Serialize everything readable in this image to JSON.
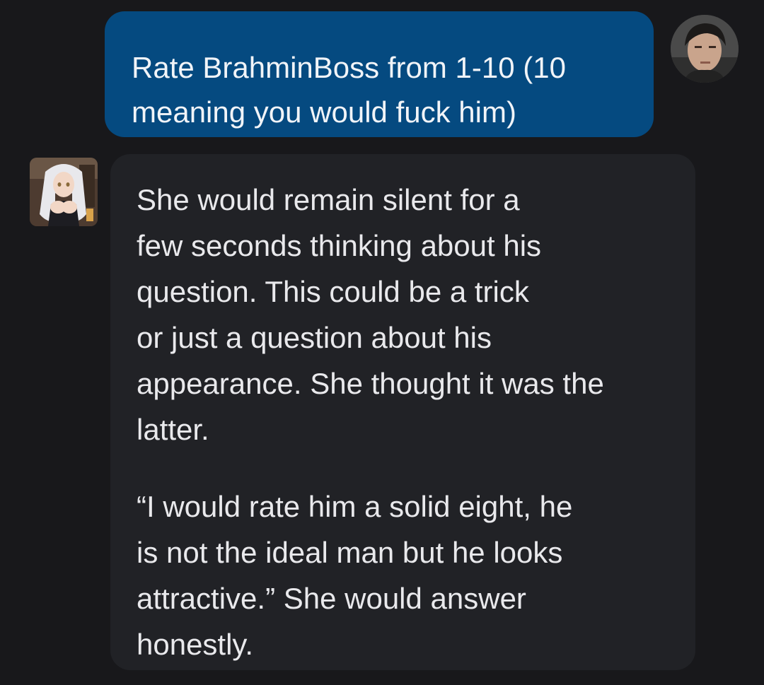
{
  "messages": {
    "user": {
      "text": "Rate BrahminBoss from 1-10 (10\nmeaning you would fuck him)"
    },
    "bot": {
      "paragraph_1": "She would remain silent for a\nfew seconds thinking about his\nquestion. This could be a trick\nor just a question about his\nappearance. She thought it was the\nlatter.",
      "paragraph_2": "“I would rate him a solid eight, he\nis not the ideal man but he looks\nattractive.” She would answer\nhonestly."
    }
  },
  "colors": {
    "background": "#18181b",
    "user_bubble": "#054a80",
    "bot_bubble": "#212226",
    "text": "#e9e9ec"
  }
}
